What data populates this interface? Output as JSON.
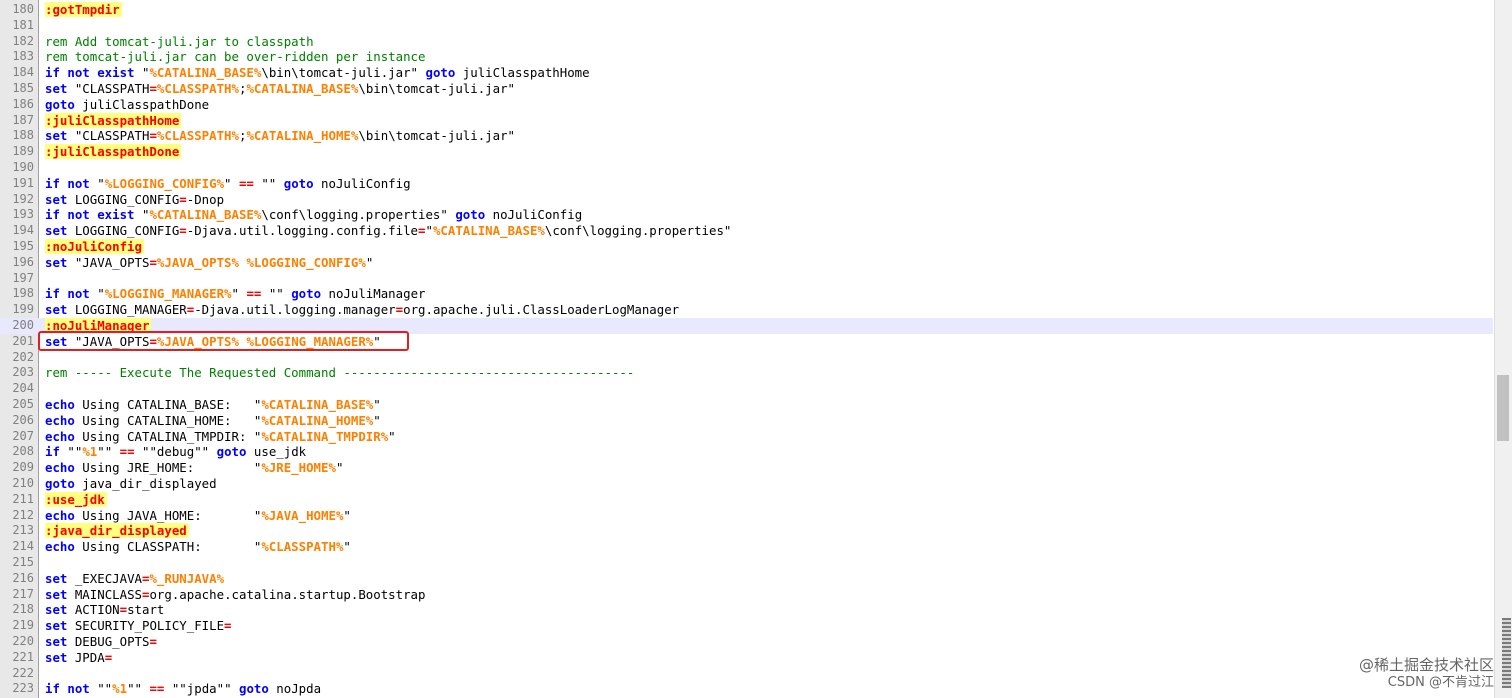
{
  "editor": {
    "current_line": "200",
    "lines": [
      {
        "n": "180",
        "t": [
          [
            "lbl",
            ":gotTmpdir"
          ]
        ]
      },
      {
        "n": "181",
        "t": []
      },
      {
        "n": "182",
        "t": [
          [
            "cmt",
            "rem Add tomcat-juli.jar to classpath"
          ]
        ]
      },
      {
        "n": "183",
        "t": [
          [
            "cmt",
            "rem tomcat-juli.jar can be over-ridden per instance"
          ]
        ]
      },
      {
        "n": "184",
        "t": [
          [
            "kw",
            "if not exist"
          ],
          [
            "txt",
            " \""
          ],
          [
            "var",
            "%CATALINA_BASE%"
          ],
          [
            "txt",
            "\\bin\\tomcat-juli.jar\" "
          ],
          [
            "kw",
            "goto"
          ],
          [
            "txt",
            " juliClasspathHome"
          ]
        ]
      },
      {
        "n": "185",
        "t": [
          [
            "kw",
            "set"
          ],
          [
            "txt",
            " \"CLASSPATH"
          ],
          [
            "op",
            "="
          ],
          [
            "var",
            "%CLASSPATH%"
          ],
          [
            "txt",
            ";"
          ],
          [
            "var",
            "%CATALINA_BASE%"
          ],
          [
            "txt",
            "\\bin\\tomcat-juli.jar\""
          ]
        ]
      },
      {
        "n": "186",
        "t": [
          [
            "kw",
            "goto"
          ],
          [
            "txt",
            " juliClasspathDone"
          ]
        ]
      },
      {
        "n": "187",
        "t": [
          [
            "lbl",
            ":juliClasspathHome"
          ]
        ]
      },
      {
        "n": "188",
        "t": [
          [
            "kw",
            "set"
          ],
          [
            "txt",
            " \"CLASSPATH"
          ],
          [
            "op",
            "="
          ],
          [
            "var",
            "%CLASSPATH%"
          ],
          [
            "txt",
            ";"
          ],
          [
            "var",
            "%CATALINA_HOME%"
          ],
          [
            "txt",
            "\\bin\\tomcat-juli.jar\""
          ]
        ]
      },
      {
        "n": "189",
        "t": [
          [
            "lbl",
            ":juliClasspathDone"
          ]
        ]
      },
      {
        "n": "190",
        "t": []
      },
      {
        "n": "191",
        "t": [
          [
            "kw",
            "if not"
          ],
          [
            "txt",
            " \""
          ],
          [
            "var",
            "%LOGGING_CONFIG%"
          ],
          [
            "txt",
            "\" "
          ],
          [
            "op",
            "=="
          ],
          [
            "txt",
            " \"\" "
          ],
          [
            "kw",
            "goto"
          ],
          [
            "txt",
            " noJuliConfig"
          ]
        ]
      },
      {
        "n": "192",
        "t": [
          [
            "kw",
            "set"
          ],
          [
            "txt",
            " LOGGING_CONFIG"
          ],
          [
            "op",
            "="
          ],
          [
            "txt",
            "-Dnop"
          ]
        ]
      },
      {
        "n": "193",
        "t": [
          [
            "kw",
            "if not exist"
          ],
          [
            "txt",
            " \""
          ],
          [
            "var",
            "%CATALINA_BASE%"
          ],
          [
            "txt",
            "\\conf\\logging.properties\" "
          ],
          [
            "kw",
            "goto"
          ],
          [
            "txt",
            " noJuliConfig"
          ]
        ]
      },
      {
        "n": "194",
        "t": [
          [
            "kw",
            "set"
          ],
          [
            "txt",
            " LOGGING_CONFIG"
          ],
          [
            "op",
            "="
          ],
          [
            "txt",
            "-Djava.util.logging.config.file"
          ],
          [
            "op",
            "="
          ],
          [
            "txt",
            "\""
          ],
          [
            "var",
            "%CATALINA_BASE%"
          ],
          [
            "txt",
            "\\conf\\logging.properties\""
          ]
        ]
      },
      {
        "n": "195",
        "t": [
          [
            "lbl",
            ":noJuliConfig"
          ]
        ]
      },
      {
        "n": "196",
        "t": [
          [
            "kw",
            "set"
          ],
          [
            "txt",
            " \"JAVA_OPTS"
          ],
          [
            "op",
            "="
          ],
          [
            "var",
            "%JAVA_OPTS%"
          ],
          [
            "txt",
            " "
          ],
          [
            "var",
            "%LOGGING_CONFIG%"
          ],
          [
            "txt",
            "\""
          ]
        ]
      },
      {
        "n": "197",
        "t": []
      },
      {
        "n": "198",
        "t": [
          [
            "kw",
            "if not"
          ],
          [
            "txt",
            " \""
          ],
          [
            "var",
            "%LOGGING_MANAGER%"
          ],
          [
            "txt",
            "\" "
          ],
          [
            "op",
            "=="
          ],
          [
            "txt",
            " \"\" "
          ],
          [
            "kw",
            "goto"
          ],
          [
            "txt",
            " noJuliManager"
          ]
        ]
      },
      {
        "n": "199",
        "t": [
          [
            "kw",
            "set"
          ],
          [
            "txt",
            " LOGGING_MANAGER"
          ],
          [
            "op",
            "="
          ],
          [
            "txt",
            "-Djava.util.logging.manager"
          ],
          [
            "op",
            "="
          ],
          [
            "txt",
            "org.apache.juli.ClassLoaderLogManager"
          ]
        ]
      },
      {
        "n": "200",
        "t": [
          [
            "lbl",
            ":noJuliManager"
          ]
        ]
      },
      {
        "n": "201",
        "t": [
          [
            "kw",
            "set"
          ],
          [
            "txt",
            " \"JAVA_OPTS"
          ],
          [
            "op",
            "="
          ],
          [
            "var",
            "%JAVA_OPTS%"
          ],
          [
            "txt",
            " "
          ],
          [
            "var",
            "%LOGGING_MANAGER%"
          ],
          [
            "txt",
            "\""
          ]
        ]
      },
      {
        "n": "202",
        "t": []
      },
      {
        "n": "203",
        "t": [
          [
            "cmt",
            "rem ----- Execute The Requested Command ---------------------------------------"
          ]
        ]
      },
      {
        "n": "204",
        "t": []
      },
      {
        "n": "205",
        "t": [
          [
            "kw",
            "echo"
          ],
          [
            "txt",
            " Using CATALINA_BASE:   \""
          ],
          [
            "var",
            "%CATALINA_BASE%"
          ],
          [
            "txt",
            "\""
          ]
        ]
      },
      {
        "n": "206",
        "t": [
          [
            "kw",
            "echo"
          ],
          [
            "txt",
            " Using CATALINA_HOME:   \""
          ],
          [
            "var",
            "%CATALINA_HOME%"
          ],
          [
            "txt",
            "\""
          ]
        ]
      },
      {
        "n": "207",
        "t": [
          [
            "kw",
            "echo"
          ],
          [
            "txt",
            " Using CATALINA_TMPDIR: \""
          ],
          [
            "var",
            "%CATALINA_TMPDIR%"
          ],
          [
            "txt",
            "\""
          ]
        ]
      },
      {
        "n": "208",
        "t": [
          [
            "kw",
            "if"
          ],
          [
            "txt",
            " \"\""
          ],
          [
            "var",
            "%1"
          ],
          [
            "txt",
            "\"\" "
          ],
          [
            "op",
            "=="
          ],
          [
            "txt",
            " \"\"debug\"\" "
          ],
          [
            "kw",
            "goto"
          ],
          [
            "txt",
            " use_jdk"
          ]
        ]
      },
      {
        "n": "209",
        "t": [
          [
            "kw",
            "echo"
          ],
          [
            "txt",
            " Using JRE_HOME:        \""
          ],
          [
            "var",
            "%JRE_HOME%"
          ],
          [
            "txt",
            "\""
          ]
        ]
      },
      {
        "n": "210",
        "t": [
          [
            "kw",
            "goto"
          ],
          [
            "txt",
            " java_dir_displayed"
          ]
        ]
      },
      {
        "n": "211",
        "t": [
          [
            "lbl",
            ":use_jdk"
          ]
        ]
      },
      {
        "n": "212",
        "t": [
          [
            "kw",
            "echo"
          ],
          [
            "txt",
            " Using JAVA_HOME:       \""
          ],
          [
            "var",
            "%JAVA_HOME%"
          ],
          [
            "txt",
            "\""
          ]
        ]
      },
      {
        "n": "213",
        "t": [
          [
            "lbl",
            ":java_dir_displayed"
          ]
        ]
      },
      {
        "n": "214",
        "t": [
          [
            "kw",
            "echo"
          ],
          [
            "txt",
            " Using CLASSPATH:       \""
          ],
          [
            "var",
            "%CLASSPATH%"
          ],
          [
            "txt",
            "\""
          ]
        ]
      },
      {
        "n": "215",
        "t": []
      },
      {
        "n": "216",
        "t": [
          [
            "kw",
            "set"
          ],
          [
            "txt",
            " _EXECJAVA"
          ],
          [
            "op",
            "="
          ],
          [
            "var",
            "%_RUNJAVA%"
          ]
        ]
      },
      {
        "n": "217",
        "t": [
          [
            "kw",
            "set"
          ],
          [
            "txt",
            " MAINCLASS"
          ],
          [
            "op",
            "="
          ],
          [
            "txt",
            "org.apache.catalina.startup.Bootstrap"
          ]
        ]
      },
      {
        "n": "218",
        "t": [
          [
            "kw",
            "set"
          ],
          [
            "txt",
            " ACTION"
          ],
          [
            "op",
            "="
          ],
          [
            "txt",
            "start"
          ]
        ]
      },
      {
        "n": "219",
        "t": [
          [
            "kw",
            "set"
          ],
          [
            "txt",
            " SECURITY_POLICY_FILE"
          ],
          [
            "op",
            "="
          ]
        ]
      },
      {
        "n": "220",
        "t": [
          [
            "kw",
            "set"
          ],
          [
            "txt",
            " DEBUG_OPTS"
          ],
          [
            "op",
            "="
          ]
        ]
      },
      {
        "n": "221",
        "t": [
          [
            "kw",
            "set"
          ],
          [
            "txt",
            " JPDA"
          ],
          [
            "op",
            "="
          ]
        ]
      },
      {
        "n": "222",
        "t": []
      },
      {
        "n": "223",
        "t": [
          [
            "kw",
            "if not"
          ],
          [
            "txt",
            " \"\""
          ],
          [
            "var",
            "%1"
          ],
          [
            "txt",
            "\"\" "
          ],
          [
            "op",
            "=="
          ],
          [
            "txt",
            " \"\"jpda\"\" "
          ],
          [
            "kw",
            "goto"
          ],
          [
            "txt",
            " noJpda"
          ]
        ]
      }
    ]
  },
  "watermark": {
    "line1": "@稀土掘金技术社区",
    "line2": "CSDN @不肯过江"
  }
}
